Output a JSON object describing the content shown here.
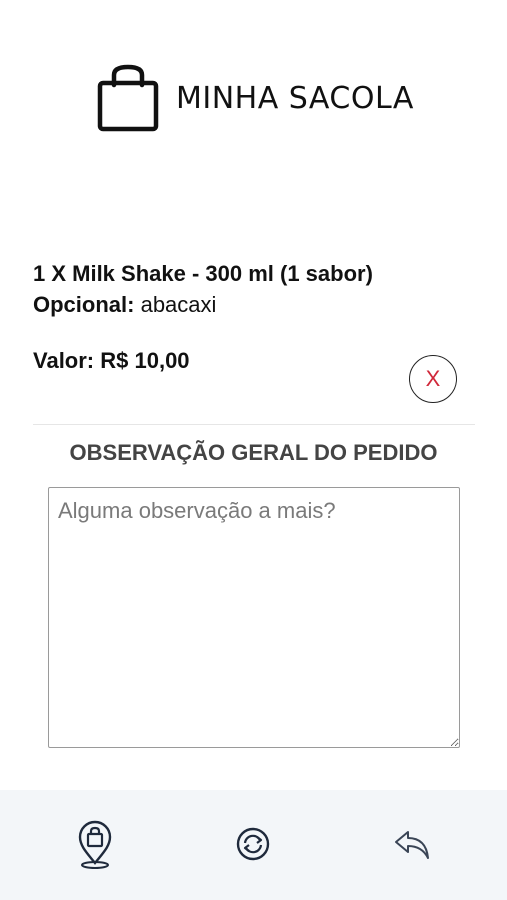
{
  "header": {
    "title": "MINHA SACOLA",
    "icon": "shopping-bag-icon"
  },
  "cart_item": {
    "title": "1 X Milk Shake - 300 ml (1 sabor)",
    "optional_label": "Opcional:",
    "optional_value": "abacaxi",
    "price": "Valor: R$ 10,00",
    "remove_label": "X"
  },
  "observation": {
    "title": "OBSERVAÇÃO GERAL DO PEDIDO",
    "placeholder": "Alguma observação a mais?",
    "value": ""
  },
  "footer_nav": [
    {
      "icon": "bag-location-icon"
    },
    {
      "icon": "refresh-icon"
    },
    {
      "icon": "back-arrow-icon"
    }
  ],
  "colors": {
    "remove_x": "#d0283a",
    "footer_bg": "#f3f6f9"
  }
}
